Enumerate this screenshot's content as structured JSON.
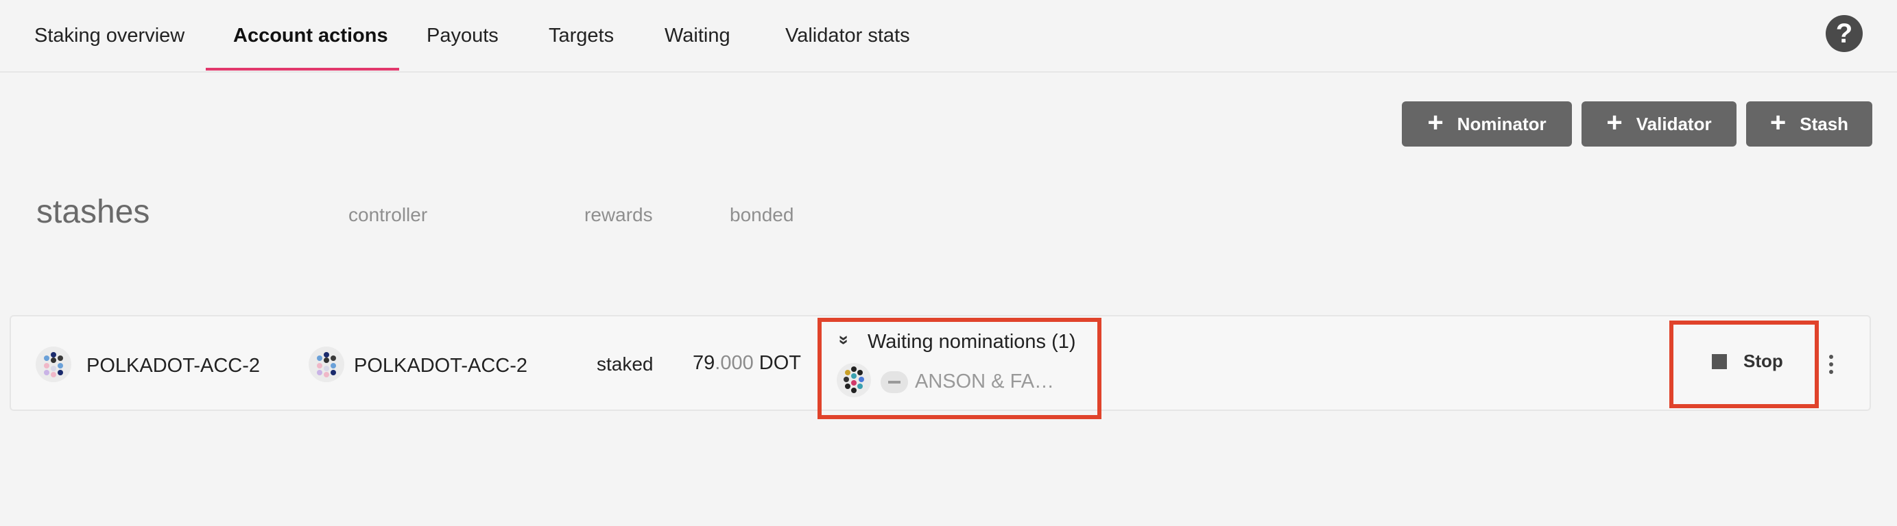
{
  "tabs": [
    {
      "label": "Staking overview",
      "active": false
    },
    {
      "label": "Account actions",
      "active": true
    },
    {
      "label": "Payouts",
      "active": false
    },
    {
      "label": "Targets",
      "active": false
    },
    {
      "label": "Waiting",
      "active": false
    },
    {
      "label": "Validator stats",
      "active": false
    }
  ],
  "help_icon": "?",
  "toolbar": {
    "nominator_label": "Nominator",
    "validator_label": "Validator",
    "stash_label": "Stash",
    "plus_glyph": "+"
  },
  "headers": {
    "stashes": "stashes",
    "controller": "controller",
    "rewards": "rewards",
    "bonded": "bonded"
  },
  "row": {
    "stash_name": "POLKADOT-ACC-2",
    "controller_name": "POLKADOT-ACC-2",
    "rewards": "staked",
    "bonded_int": "79",
    "bonded_dec": ".000",
    "bonded_unit": "DOT",
    "nominations_label": "Waiting nominations (1)",
    "nominee_name": "ANSON & FA…",
    "stop_label": "Stop"
  },
  "colors": {
    "accent": "#e2386c",
    "highlight": "#e0432b",
    "button_bg": "#666666"
  }
}
